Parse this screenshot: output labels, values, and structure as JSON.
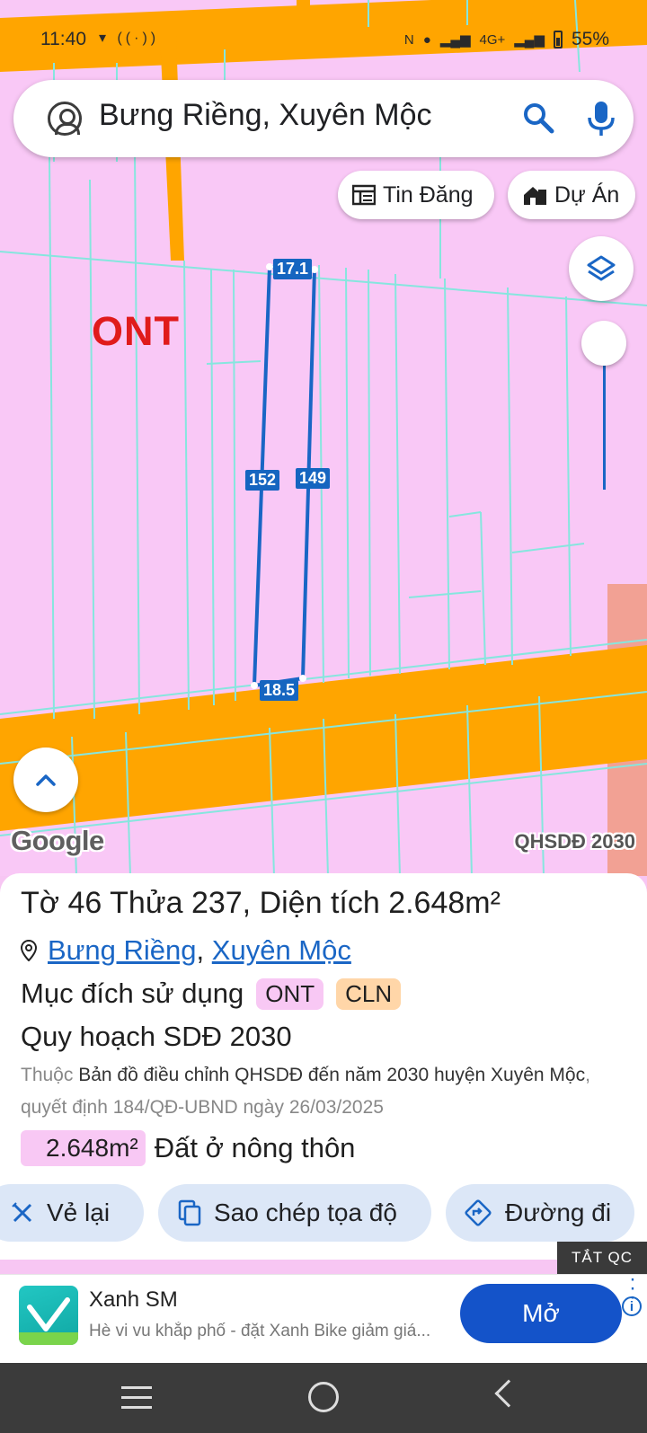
{
  "status_bar": {
    "time": "11:40",
    "battery": "55%",
    "network": "4G+"
  },
  "search": {
    "query": "Bưng Riềng, Xuyên Mộc"
  },
  "chips": {
    "tin_dang": "Tin Đăng",
    "du_an": "Dự Án"
  },
  "map": {
    "zone_label": "ONT",
    "dimensions": {
      "top": "17.1",
      "left": "152",
      "right": "149",
      "bottom": "18.5"
    },
    "google_label": "Google",
    "plan_label": "QHSDĐ 2030"
  },
  "sheet": {
    "title": "Tờ 46 Thửa 237, Diện tích 2.648m²",
    "location_commune": "Bưng Riềng",
    "location_separator": ",",
    "location_district": "Xuyên Mộc",
    "purpose_label": "Mục đích sử dụng",
    "purpose_tags": [
      "ONT",
      "CLN"
    ],
    "plan_title": "Quy hoạch SDĐ 2030",
    "desc_prefix": "Thuộc",
    "desc_doc": "Bản đồ điều chỉnh QHSDĐ đến năm 2030 huyện Xuyên Mộc",
    "desc_suffix": ", quyết định 184/QĐ-UBND ngày 26/03/2025",
    "area_value": "2.648m²",
    "area_type": "Đất ở nông thôn"
  },
  "actions": {
    "redraw": "Vẻ lại",
    "copy_coords": "Sao chép tọa độ",
    "directions": "Đường đi"
  },
  "ad": {
    "close_label": "TẮT QC",
    "title": "Xanh SM",
    "subtitle": "Hè vi vu khắp phố - đặt Xanh Bike giảm giá...",
    "open_label": "Mở"
  },
  "colors": {
    "accent": "#1a66c5",
    "road": "#ffa500",
    "land_ont": "#f9c8f6",
    "parcel_line": "#7fe8e0",
    "ad_button": "#1453c9"
  }
}
